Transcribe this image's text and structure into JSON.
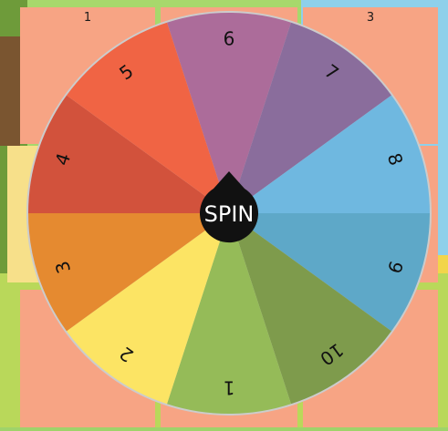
{
  "board": {
    "tiles": [
      {
        "label": "1"
      },
      {
        "label": ""
      },
      {
        "label": "3"
      }
    ]
  },
  "wheel": {
    "spin_label": "SPIN",
    "segments": [
      {
        "label": "6",
        "color": "#ac6c9a"
      },
      {
        "label": "7",
        "color": "#8a6d9c"
      },
      {
        "label": "8",
        "color": "#6fb8e0"
      },
      {
        "label": "9",
        "color": "#5ea8c8"
      },
      {
        "label": "10",
        "color": "#7e9b4c"
      },
      {
        "label": "1",
        "color": "#95bb58"
      },
      {
        "label": "2",
        "color": "#fce464"
      },
      {
        "label": "3",
        "color": "#e58a30"
      },
      {
        "label": "4",
        "color": "#d2523c"
      },
      {
        "label": "5",
        "color": "#f06444"
      }
    ],
    "hub_color": "#111111",
    "rim_color": "#cccccc"
  },
  "colors": {
    "tile": "#f7a484",
    "grass": "#9fd36a",
    "water": "#8ed0ea"
  }
}
